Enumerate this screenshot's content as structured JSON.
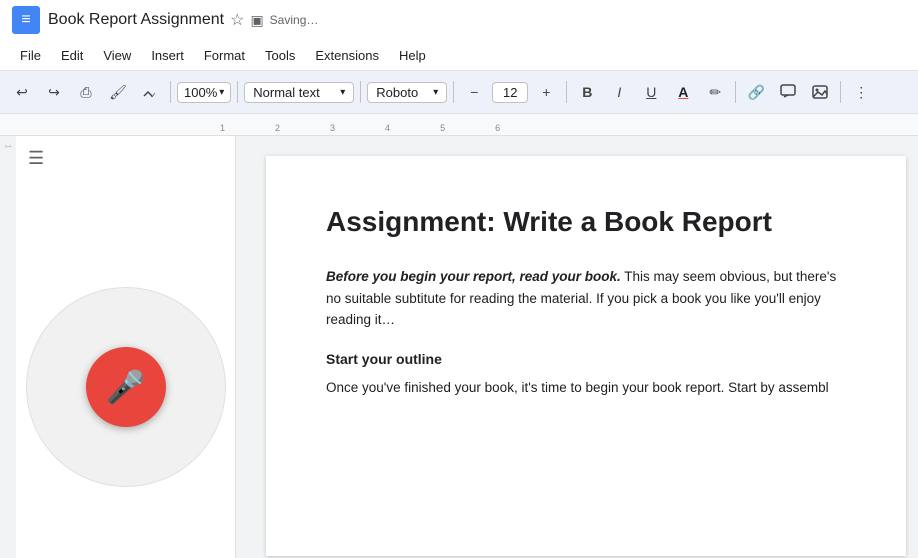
{
  "titlebar": {
    "doc_icon": "≡",
    "title": "Book Report Assignment",
    "star_icon": "☆",
    "drive_icon": "▣",
    "saving": "Saving…"
  },
  "menubar": {
    "items": [
      "File",
      "Edit",
      "View",
      "Insert",
      "Format",
      "Tools",
      "Extensions",
      "Help"
    ]
  },
  "toolbar": {
    "undo_label": "↩",
    "redo_label": "↪",
    "print_label": "⎙",
    "paintformat_label": "🖌",
    "spellcheck_label": "✓",
    "zoom_label": "100%",
    "zoom_chevron": "▾",
    "style_label": "Normal text",
    "style_chevron": "▾",
    "font_label": "Roboto",
    "font_chevron": "▾",
    "minus_label": "−",
    "fontsize_label": "12",
    "plus_label": "+",
    "bold_label": "B",
    "italic_label": "I",
    "underline_label": "U",
    "fontcolor_label": "A",
    "highlight_label": "✏",
    "link_label": "🔗",
    "comment_label": "💬",
    "image_label": "🖼",
    "more_label": "≡"
  },
  "ruler": {
    "ticks": [
      "1",
      "2",
      "3",
      "4",
      "5",
      "6"
    ]
  },
  "outline_icon": "☰",
  "document": {
    "heading": "Assignment: Write a Book Report",
    "paragraph1_bold_italic": "Before you begin your report, read your book.",
    "paragraph1_rest": " This may seem obvious, but there's no suitable subtitute for reading the material. If you pick a book you like you'll enjoy reading it…",
    "subheading": "Start your outline",
    "paragraph2": "Once you've finished your book, it's time to begin your book report. Start by assembl"
  }
}
